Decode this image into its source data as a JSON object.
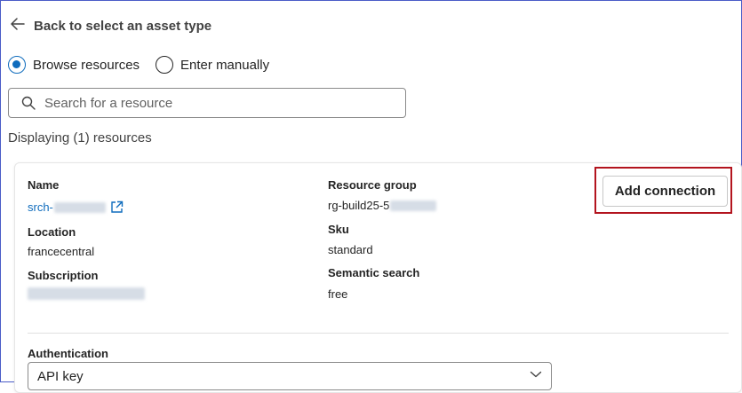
{
  "back": {
    "label": "Back to select an asset type"
  },
  "mode": {
    "options": [
      {
        "label": "Browse resources",
        "selected": true
      },
      {
        "label": "Enter manually",
        "selected": false
      }
    ]
  },
  "search": {
    "placeholder": "Search for a resource",
    "value": ""
  },
  "results": {
    "count_text": "Displaying (1) resources"
  },
  "resource": {
    "name_label": "Name",
    "name_value": "srch-",
    "location_label": "Location",
    "location_value": "francecentral",
    "subscription_label": "Subscription",
    "resource_group_label": "Resource group",
    "resource_group_value": "rg-build25-5",
    "sku_label": "Sku",
    "sku_value": "standard",
    "semantic_label": "Semantic search",
    "semantic_value": "free",
    "add_connection_label": "Add connection"
  },
  "auth": {
    "label": "Authentication",
    "selected": "API key"
  },
  "colors": {
    "accent": "#0f6cbd",
    "highlight_border": "#b3141e",
    "frame_border": "#4a5cc7"
  },
  "icons": {
    "back": "arrow-left-icon",
    "search": "search-icon",
    "external": "open-external-icon",
    "dropdown": "chevron-down-icon"
  }
}
